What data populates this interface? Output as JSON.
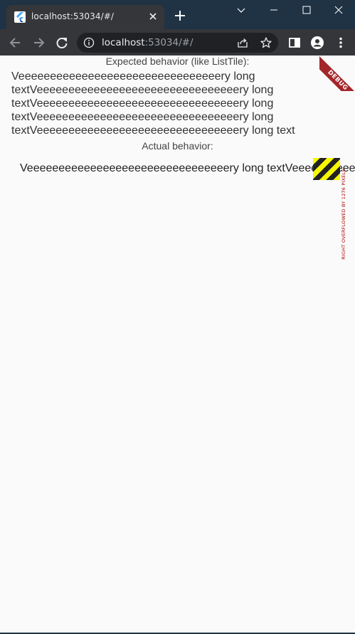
{
  "browser": {
    "tab": {
      "title": "localhost:53034/#/",
      "favicon": "flutter-icon"
    },
    "new_tab_icon": "plus-icon",
    "window_controls": [
      "chevron-down-icon",
      "minimize-icon",
      "maximize-icon",
      "close-icon"
    ],
    "address": {
      "host": "localhost",
      "rest": ":53034/#/"
    },
    "colors": {
      "titlebar": "#1f3345",
      "toolbar": "#35363a",
      "omnibox": "#202124",
      "page_background": "#fafafa"
    }
  },
  "page": {
    "expected_heading": "Expected behavior (like ListTile):",
    "expected_lines": [
      "Veeeeeeeeeeeeeeeeeeeeeeeeeeeeeeeery long",
      "textVeeeeeeeeeeeeeeeeeeeeeeeeeeeeeeeery long",
      "textVeeeeeeeeeeeeeeeeeeeeeeeeeeeeeeeery long",
      "textVeeeeeeeeeeeeeeeeeeeeeeeeeeeeeeeery long",
      "textVeeeeeeeeeeeeeeeeeeeeeeeeeeeeeeeery long text"
    ],
    "actual_heading": "Actual behavior:",
    "actual_text": "Veeeeeeeeeeeeeeeeeeeeeeeeeeeeeeeery long textVeeeeeeeeeeeeeeeeeeeeeeeeeeeeeeeery long textVeeeeeeeeeeeeeeeeeeeeeeeeeeeeeeeery long text",
    "overflow_message": "RIGHT OVERFLOWED BY 1276 PIXELS",
    "debug_banner": "DEBUG",
    "colors": {
      "debug_banner": "#a3262a",
      "overflow_stripe_yellow": "#f7f700",
      "overflow_stripe_dark": "#222222",
      "overflow_text": "#b00000"
    }
  }
}
